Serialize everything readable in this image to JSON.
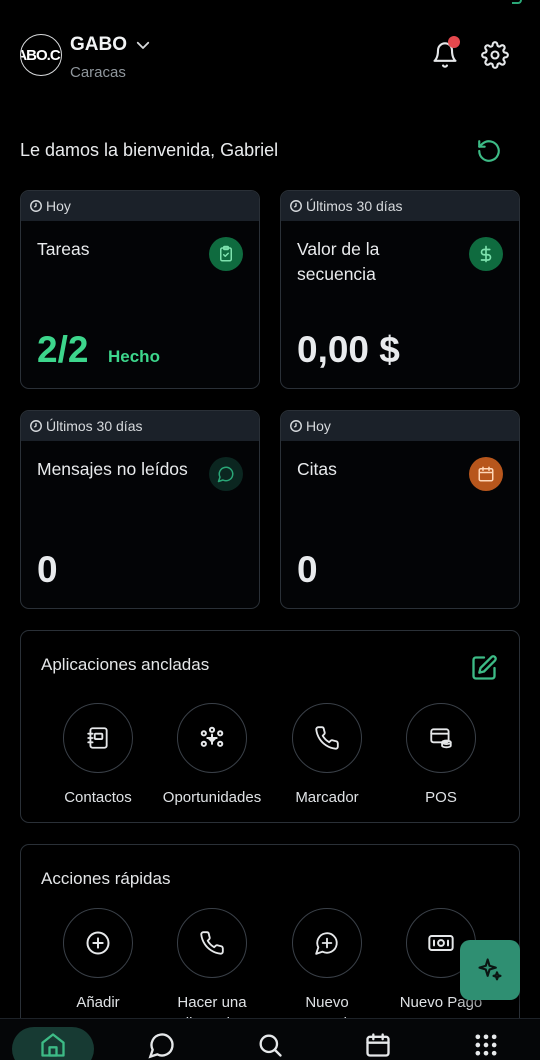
{
  "header": {
    "avatar_text": "ABO.C",
    "account_name": "GABO",
    "location": "Caracas"
  },
  "welcome_text": "Le damos la bienvenida, Gabriel",
  "stats": [
    {
      "period": "Hoy",
      "title": "Tareas",
      "value": "2/2",
      "status": "Hecho",
      "icon": "clipboard-check-icon",
      "badge_color": "#0f6b3f"
    },
    {
      "period": "Últimos 30 días",
      "title": "Valor de la secuencia",
      "value": "0,00 $",
      "icon": "dollar-icon",
      "badge_color": "#0f6b3f"
    },
    {
      "period": "Últimos 30 días",
      "title": "Mensajes no leídos",
      "value": "0",
      "icon": "chat-icon",
      "badge_color": "#0b2620"
    },
    {
      "period": "Hoy",
      "title": "Citas",
      "value": "0",
      "icon": "calendar-icon",
      "badge_color": "#b7561c"
    }
  ],
  "pinned": {
    "title": "Aplicaciones ancladas",
    "apps": [
      {
        "label": "Contactos",
        "icon": "contact-book-icon"
      },
      {
        "label": "Oportunidades",
        "icon": "pipeline-icon"
      },
      {
        "label": "Marcador",
        "icon": "phone-icon"
      },
      {
        "label": "POS",
        "icon": "pos-icon"
      }
    ]
  },
  "quick": {
    "title": "Acciones rápidas",
    "actions": [
      {
        "label": "Añadir Contacto",
        "icon": "plus-circle-icon"
      },
      {
        "label": "Hacer una llamada",
        "icon": "phone-icon"
      },
      {
        "label": "Nuevo mensaje",
        "icon": "chat-plus-icon"
      },
      {
        "label": "Nuevo Pago",
        "icon": "money-icon"
      }
    ]
  },
  "colors": {
    "accent": "#3dd68c",
    "fab": "#2f8f72",
    "notification": "#e5484d",
    "card_header": "#1b2129"
  }
}
